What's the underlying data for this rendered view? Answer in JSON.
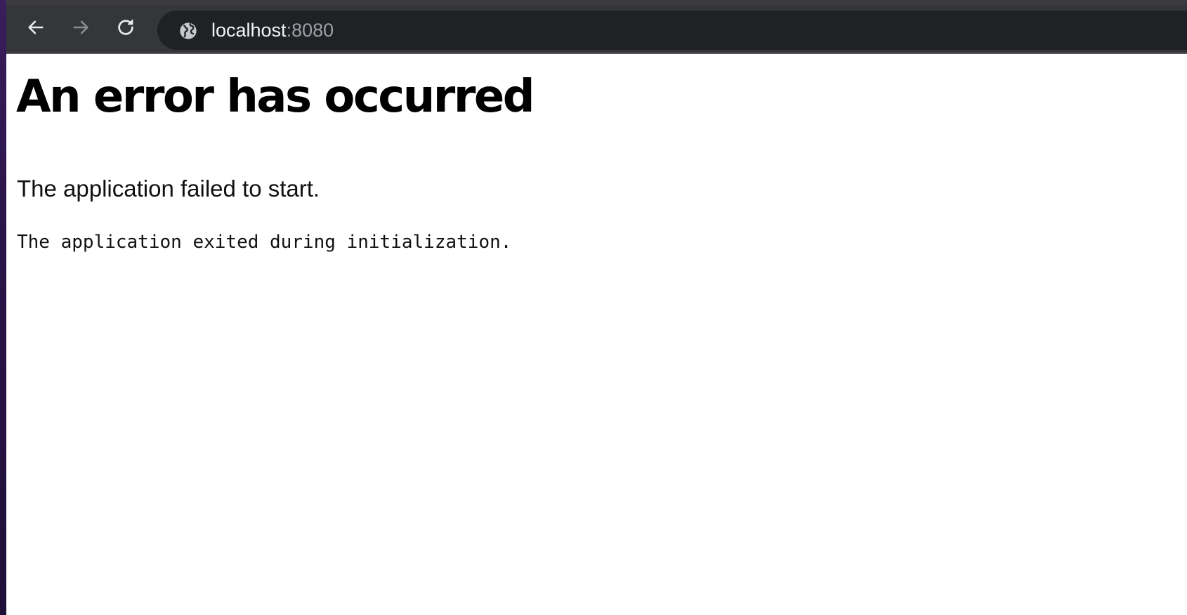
{
  "browser": {
    "url_host": "localhost",
    "url_port": ":8080",
    "icons": {
      "back": "back-arrow-icon",
      "forward": "forward-arrow-icon",
      "reload": "reload-icon",
      "site_info": "globe-icon"
    },
    "forward_enabled": false
  },
  "page": {
    "title": "An error has occurred",
    "subtitle": "The application failed to start.",
    "detail": "The application exited during initialization."
  },
  "colors": {
    "toolbar": "#35363a",
    "omnibox": "#202124",
    "page_background": "#ffffff",
    "text": "#000000"
  }
}
